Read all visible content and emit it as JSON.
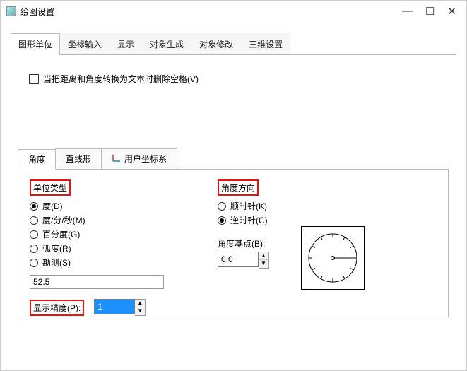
{
  "window": {
    "title": "绘图设置"
  },
  "winctrl": {
    "min": "—",
    "max": "☐",
    "close": "✕"
  },
  "tabs": [
    "图形单位",
    "坐标输入",
    "显示",
    "对象生成",
    "对象修改",
    "三维设置"
  ],
  "checkbox": {
    "label": "当把距离和角度转换为文本时删除空格(V)"
  },
  "subtabs": {
    "t0": "角度",
    "t1": "直线形",
    "t2": "用户坐标系"
  },
  "unit_type": {
    "label": "单位类型",
    "options": [
      "度(D)",
      "度/分/秒(M)",
      "百分度(G)",
      "弧度(R)",
      "勘测(S)"
    ],
    "value_field": "52.5"
  },
  "display_precision": {
    "label": "显示精度(P):",
    "value": "1"
  },
  "angle_dir": {
    "label": "角度方向",
    "opt_cw": "顺时针(K)",
    "opt_ccw": "逆时针(C)"
  },
  "base_point": {
    "label": "角度基点(B):",
    "value": "0.0"
  }
}
